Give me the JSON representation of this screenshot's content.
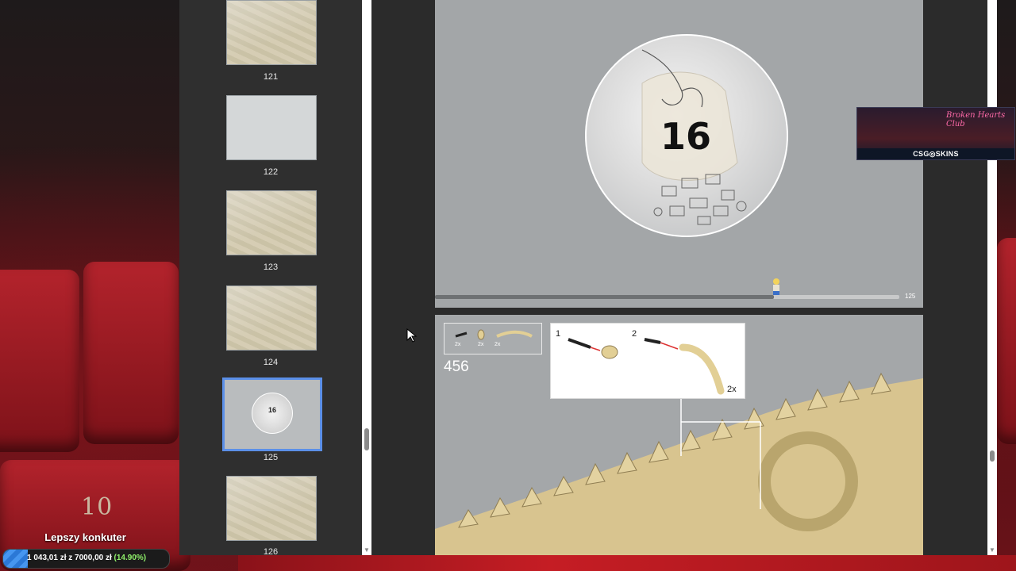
{
  "thumbnails": [
    {
      "label": "121"
    },
    {
      "label": "122"
    },
    {
      "label": "123"
    },
    {
      "label": "124"
    },
    {
      "label": "125",
      "selected": true,
      "bag_number": "16"
    },
    {
      "label": "126"
    }
  ],
  "current_page": {
    "bag_number": "16",
    "progress_page": "125",
    "progress_fraction": 0.73
  },
  "step": {
    "number": "456",
    "parts": [
      {
        "qty": "2x",
        "icon": "axle-pin-icon"
      },
      {
        "qty": "2x",
        "icon": "round-brick-icon"
      },
      {
        "qty": "2x",
        "icon": "curved-horn-icon"
      }
    ],
    "sub_steps": [
      {
        "number": "1"
      },
      {
        "number": "2"
      }
    ],
    "sub_qty": "2x"
  },
  "ad": {
    "sign_text": "Broken Hearts Club",
    "brand": "CSG◎SKINS"
  },
  "donation": {
    "title": "Lepszy konkuter",
    "amount_text": "1 043,01 zł z 7000,00 zł",
    "percent_text": "(14.90%)",
    "fraction": 0.149
  },
  "background": {
    "seat_number": "10"
  },
  "colors": {
    "selection": "#5b8fe8",
    "progress": "#6e7173",
    "donate_fill": "#2b78d6",
    "donate_percent": "#8ff06a"
  }
}
